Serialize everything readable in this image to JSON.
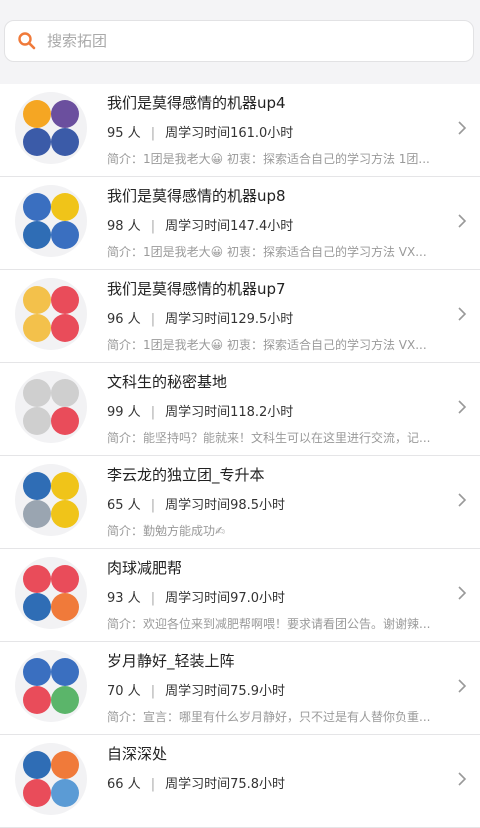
{
  "search": {
    "placeholder": "搜索拓团"
  },
  "items": [
    {
      "title": "我们是莫得感情的机器up4",
      "members": "95 人",
      "study": "周学习时间161.0小时",
      "intro": "简介：1团是我老大😀 初衷：探索适合自己的学习方法 1团..."
    },
    {
      "title": "我们是莫得感情的机器up8",
      "members": "98 人",
      "study": "周学习时间147.4小时",
      "intro": "简介：1团是我老大😀 初衷：探索适合自己的学习方法 VX..."
    },
    {
      "title": "我们是莫得感情的机器up7",
      "members": "96 人",
      "study": "周学习时间129.5小时",
      "intro": "简介：1团是我老大😀 初衷：探索适合自己的学习方法 VX..."
    },
    {
      "title": "文科生的秘密基地",
      "members": "99 人",
      "study": "周学习时间118.2小时",
      "intro": "简介：能坚持吗？能就来！文科生可以在这里进行交流，记..."
    },
    {
      "title": "李云龙的独立团_专升本",
      "members": "65 人",
      "study": "周学习时间98.5小时",
      "intro": "简介：勤勉方能成功✍"
    },
    {
      "title": "肉球减肥帮",
      "members": "93 人",
      "study": "周学习时间97.0小时",
      "intro": "简介：欢迎各位来到减肥帮啊喂！要求请看团公告。谢谢辣..."
    },
    {
      "title": "岁月静好_轻装上阵",
      "members": "70 人",
      "study": "周学习时间75.9小时",
      "intro": "简介：宣言：哪里有什么岁月静好，只不过是有人替你负重..."
    },
    {
      "title": "自深深处",
      "members": "66 人",
      "study": "周学习时间75.8小时",
      "intro": ""
    }
  ],
  "separator": "|",
  "colors": {
    "accent": "#f07a3a",
    "chevron": "#999999"
  },
  "avatar_colors": [
    [
      "#f5a623",
      "#6b4f9e",
      "#3b5ba8",
      "#3b5ba8"
    ],
    [
      "#3a6fc0",
      "#f0c419",
      "#2f6db5",
      "#3a6fc0"
    ],
    [
      "#f3c14b",
      "#e94c5a",
      "#f3c14b",
      "#e94c5a"
    ],
    [
      "#cfcfcf",
      "#cfcfcf",
      "#cfcfcf",
      "#e94c5a"
    ],
    [
      "#2f6db5",
      "#f0c419",
      "#9aa5b1",
      "#f0c419"
    ],
    [
      "#e94c5a",
      "#e94c5a",
      "#2f6db5",
      "#f07a3a"
    ],
    [
      "#3a6fc0",
      "#3a6fc0",
      "#e94c5a",
      "#5bb56a"
    ],
    [
      "#2f6db5",
      "#f07a3a",
      "#e94c5a",
      "#5b9bd5"
    ]
  ]
}
